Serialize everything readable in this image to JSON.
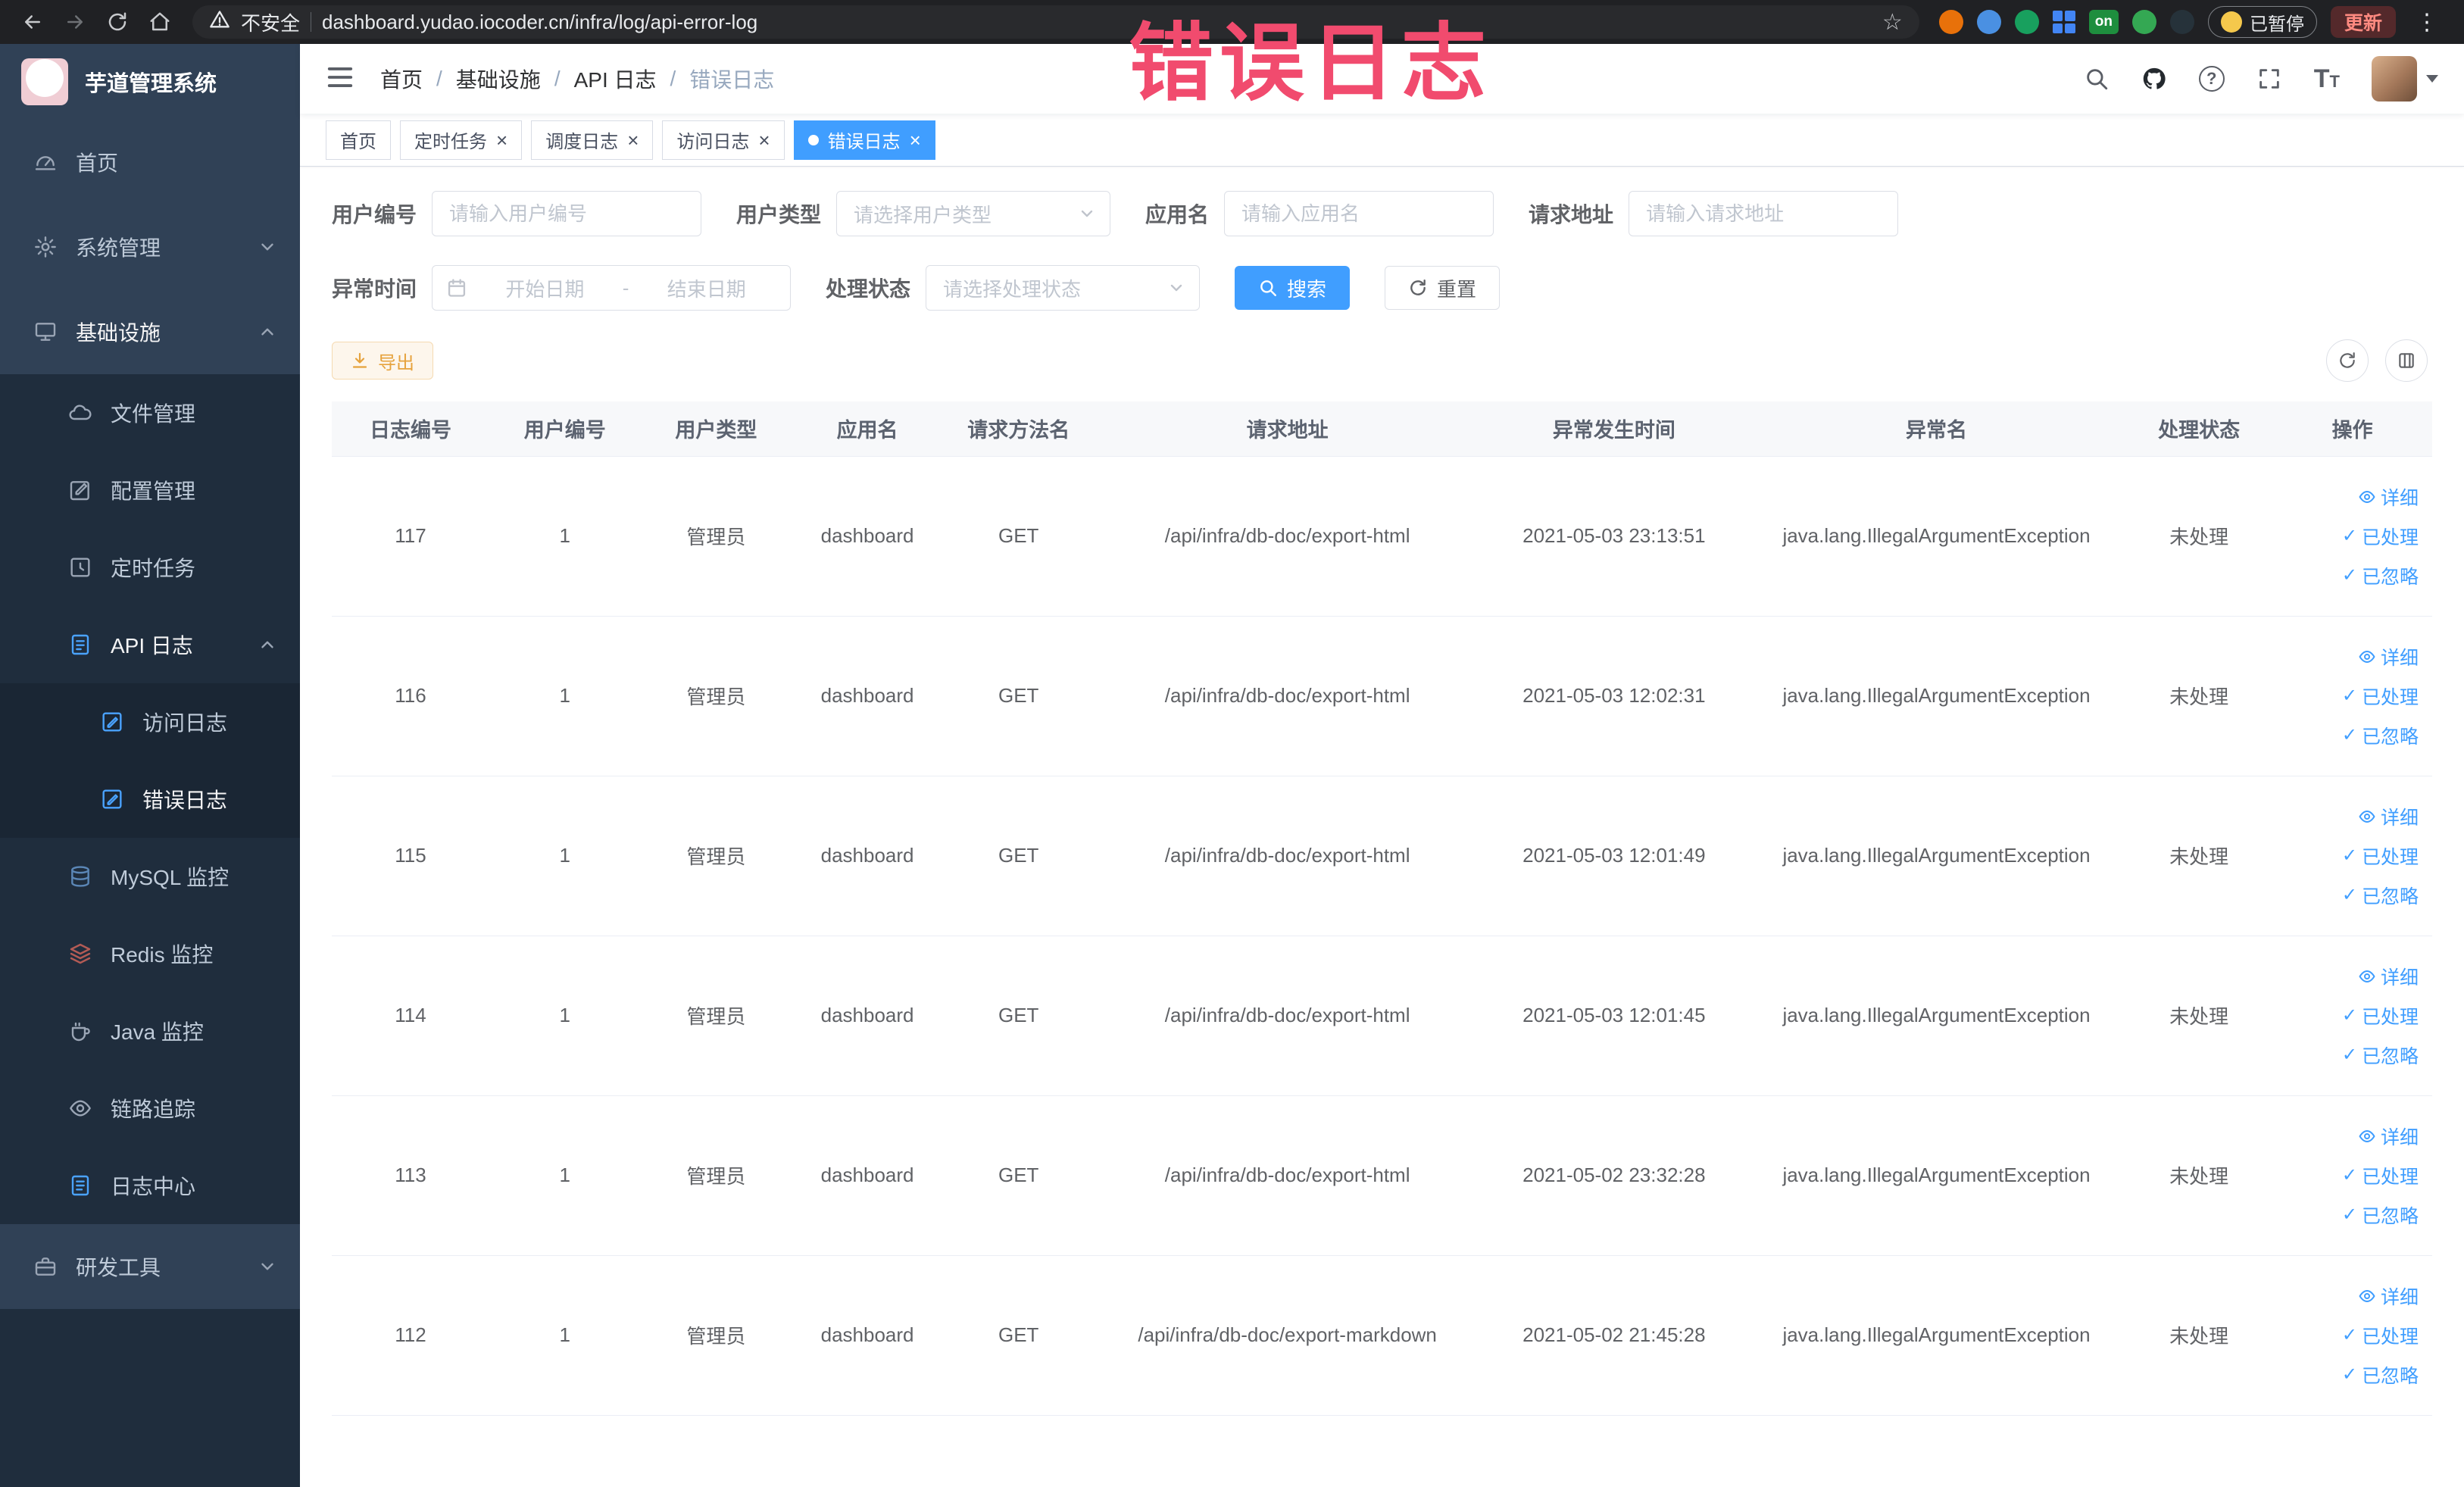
{
  "colors": {
    "accent": "#409eff",
    "warning": "#e6a23c",
    "annotation": "#f14b6e",
    "sidebar_bg": "#304156",
    "submenu_bg": "#1f2d3d"
  },
  "browser": {
    "security_label": "不安全",
    "url": "dashboard.yudao.iocoder.cn/infra/log/api-error-log",
    "extension_on_badge": "on",
    "paused_badge": "已暂停",
    "update_button": "更新"
  },
  "annotation": {
    "text": "错误日志"
  },
  "sidebar": {
    "logo_title": "芋道管理系统",
    "home": "首页",
    "system": "系统管理",
    "infra": "基础设施",
    "file": "文件管理",
    "config": "配置管理",
    "job": "定时任务",
    "api_log": "API 日志",
    "access_log": "访问日志",
    "error_log": "错误日志",
    "mysql": "MySQL 监控",
    "redis": "Redis 监控",
    "java": "Java 监控",
    "trace": "链路追踪",
    "log_center": "日志中心",
    "dev_tools": "研发工具"
  },
  "breadcrumb": {
    "items": [
      "首页",
      "基础设施",
      "API 日志",
      "错误日志"
    ]
  },
  "tabs": {
    "home": "首页",
    "job": "定时任务",
    "job_log": "调度日志",
    "access_log": "访问日志",
    "error_log": "错误日志"
  },
  "filters": {
    "user_id_label": "用户编号",
    "user_id_placeholder": "请输入用户编号",
    "user_type_label": "用户类型",
    "user_type_placeholder": "请选择用户类型",
    "app_name_label": "应用名",
    "app_name_placeholder": "请输入应用名",
    "request_url_label": "请求地址",
    "request_url_placeholder": "请输入请求地址",
    "exception_time_label": "异常时间",
    "date_start_placeholder": "开始日期",
    "date_separator": "-",
    "date_end_placeholder": "结束日期",
    "process_status_label": "处理状态",
    "process_status_placeholder": "请选择处理状态",
    "search_button": "搜索",
    "reset_button": "重置"
  },
  "toolbar": {
    "export_button": "导出"
  },
  "table": {
    "columns": [
      "日志编号",
      "用户编号",
      "用户类型",
      "应用名",
      "请求方法名",
      "请求地址",
      "异常发生时间",
      "异常名",
      "处理状态",
      "操作"
    ],
    "actions": {
      "detail": "详细",
      "processed": "已处理",
      "ignored": "已忽略"
    },
    "rows": [
      {
        "log_id": "117",
        "user_id": "1",
        "user_type": "管理员",
        "app_name": "dashboard",
        "method": "GET",
        "url": "/api/infra/db-doc/export-html",
        "time": "2021-05-03 23:13:51",
        "exception": "java.lang.IllegalArgumentException",
        "status": "未处理"
      },
      {
        "log_id": "116",
        "user_id": "1",
        "user_type": "管理员",
        "app_name": "dashboard",
        "method": "GET",
        "url": "/api/infra/db-doc/export-html",
        "time": "2021-05-03 12:02:31",
        "exception": "java.lang.IllegalArgumentException",
        "status": "未处理"
      },
      {
        "log_id": "115",
        "user_id": "1",
        "user_type": "管理员",
        "app_name": "dashboard",
        "method": "GET",
        "url": "/api/infra/db-doc/export-html",
        "time": "2021-05-03 12:01:49",
        "exception": "java.lang.IllegalArgumentException",
        "status": "未处理"
      },
      {
        "log_id": "114",
        "user_id": "1",
        "user_type": "管理员",
        "app_name": "dashboard",
        "method": "GET",
        "url": "/api/infra/db-doc/export-html",
        "time": "2021-05-03 12:01:45",
        "exception": "java.lang.IllegalArgumentException",
        "status": "未处理"
      },
      {
        "log_id": "113",
        "user_id": "1",
        "user_type": "管理员",
        "app_name": "dashboard",
        "method": "GET",
        "url": "/api/infra/db-doc/export-html",
        "time": "2021-05-02 23:32:28",
        "exception": "java.lang.IllegalArgumentException",
        "status": "未处理"
      },
      {
        "log_id": "112",
        "user_id": "1",
        "user_type": "管理员",
        "app_name": "dashboard",
        "method": "GET",
        "url": "/api/infra/db-doc/export-markdown",
        "time": "2021-05-02 21:45:28",
        "exception": "java.lang.IllegalArgumentException",
        "status": "未处理"
      }
    ]
  }
}
